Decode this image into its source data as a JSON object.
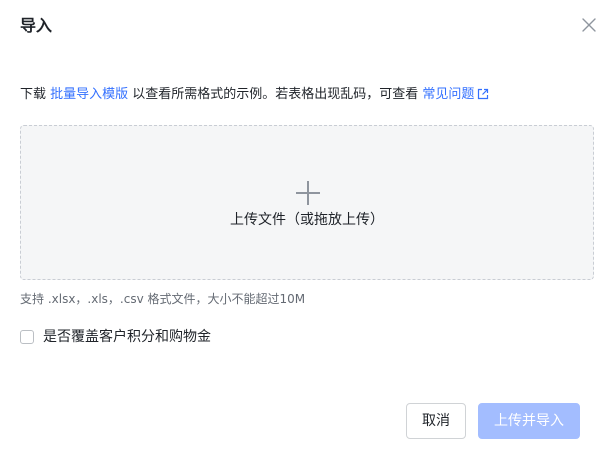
{
  "dialog": {
    "title": "导入",
    "close_label": "X"
  },
  "hint": {
    "prefix": "下载 ",
    "template_link": "批量导入模版",
    "middle": " 以查看所需格式的示例。若表格出现乱码，可查看 ",
    "faq_link": "常见问题",
    "external_icon": "external-link-icon"
  },
  "upload": {
    "icon": "plus-icon",
    "label": "上传文件（或拖放上传）"
  },
  "support_text": "支持 .xlsx，.xls，.csv 格式文件，大小不能超过10M",
  "option": {
    "label": "是否覆盖客户积分和购物金",
    "checked": false
  },
  "footer": {
    "cancel_label": "取消",
    "submit_label": "上传并导入"
  },
  "colors": {
    "link": "#3370ff",
    "primary_disabled": "#a3bdff",
    "text": "#1f2329",
    "muted": "#646a73",
    "dropzone_bg": "#f5f6f7",
    "dropzone_border": "#c9cdd4"
  }
}
